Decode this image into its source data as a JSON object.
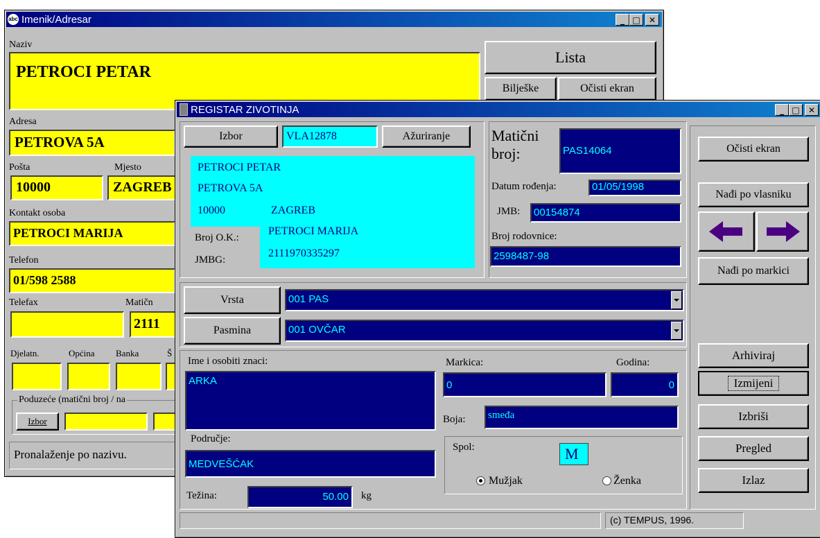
{
  "back_window": {
    "title": "Imenik/Adresar",
    "naziv_label": "Naziv",
    "naziv_value": "PETROCI PETAR",
    "adresa_label": "Adresa",
    "adresa_value": "PETROVA 5A",
    "posta_label": "Pošta",
    "posta_value": "10000",
    "mjesto_label": "Mjesto",
    "mjesto_value": "ZAGREB",
    "kontakt_label": "Kontakt osoba",
    "kontakt_value": "PETROCI MARIJA",
    "telefon_label": "Telefon",
    "telefon_value": "01/598 2588",
    "telefax_label": "Telefax",
    "maticni_label": "Matičn",
    "maticni_value": "2111",
    "djelatn_label": "Djelatn.",
    "opcina_label": "Općina",
    "banka_label": "Banka",
    "s_label": "Š",
    "poduzece_label": "Poduzeće (matični broj / na",
    "izbor_label": "Izbor",
    "status_text": "Pronalaženje po nazivu.",
    "lista_label": "Lista",
    "biljeske_label": "Bilješke",
    "ocisti_label": "Očisti ekran"
  },
  "front_window": {
    "title": "REGISTAR ZIVOTINJA",
    "izbor_label": "Izbor",
    "izbor_value": "VLA12878",
    "azuriranje_label": "Ažuriranje",
    "owner_name": "PETROCI PETAR",
    "owner_address": "PETROVA 5A",
    "owner_postcode": "10000",
    "owner_city": "ZAGREB",
    "broj_ok_label": "Broj O.K.:",
    "broj_ok_value": "PETROCI MARIJA",
    "jmbg_label": "JMBG:",
    "jmbg_value": "2111970335297",
    "maticni_label_1": "Matični",
    "maticni_label_2": "broj:",
    "maticni_value": "PAS14064",
    "datum_label": "Datum rođenja:",
    "datum_value": "01/05/1998",
    "jmb_label": "JMB:",
    "jmb_value": "00154874",
    "rodovnica_label": "Broj rodovnice:",
    "rodovnica_value": "2598487-98",
    "vrsta_label": "Vrsta",
    "vrsta_value": "001 PAS",
    "pasmina_label": "Pasmina",
    "pasmina_value": "001 OVČAR",
    "ime_label": "Ime i osobiti znaci:",
    "ime_value": "ARKA",
    "markica_label": "Markica:",
    "markica_value": "0",
    "godina_label": "Godina:",
    "godina_value": "0",
    "boja_label": "Boja:",
    "boja_value": "smeđa",
    "podrucje_label": "Područje:",
    "podrucje_value": "MEDVEŠĆAK",
    "spol_label": "Spol:",
    "spol_value": "M",
    "muzjak_label": "Mužjak",
    "zenka_label": "Ženka",
    "tezina_label": "Težina:",
    "tezina_value": "50.00",
    "tezina_unit": "kg",
    "status_right": "(c) TEMPUS, 1996.",
    "ocisti_label": "Očisti ekran",
    "nadi_vlasnik_label": "Nađi po vlasniku",
    "nadi_markica_label": "Nađi po markici",
    "arhiviraj_label": "Arhiviraj",
    "izmijeni_label": "Izmijeni",
    "izbrisi_label": "Izbriši",
    "pregled_label": "Pregled",
    "izlaz_label": "Izlaz"
  },
  "colors": {
    "yellow_field": "#ffff00",
    "navy_field": "#000080",
    "cyan_panel": "#00ffff",
    "arrow_purple": "#4b0082"
  }
}
